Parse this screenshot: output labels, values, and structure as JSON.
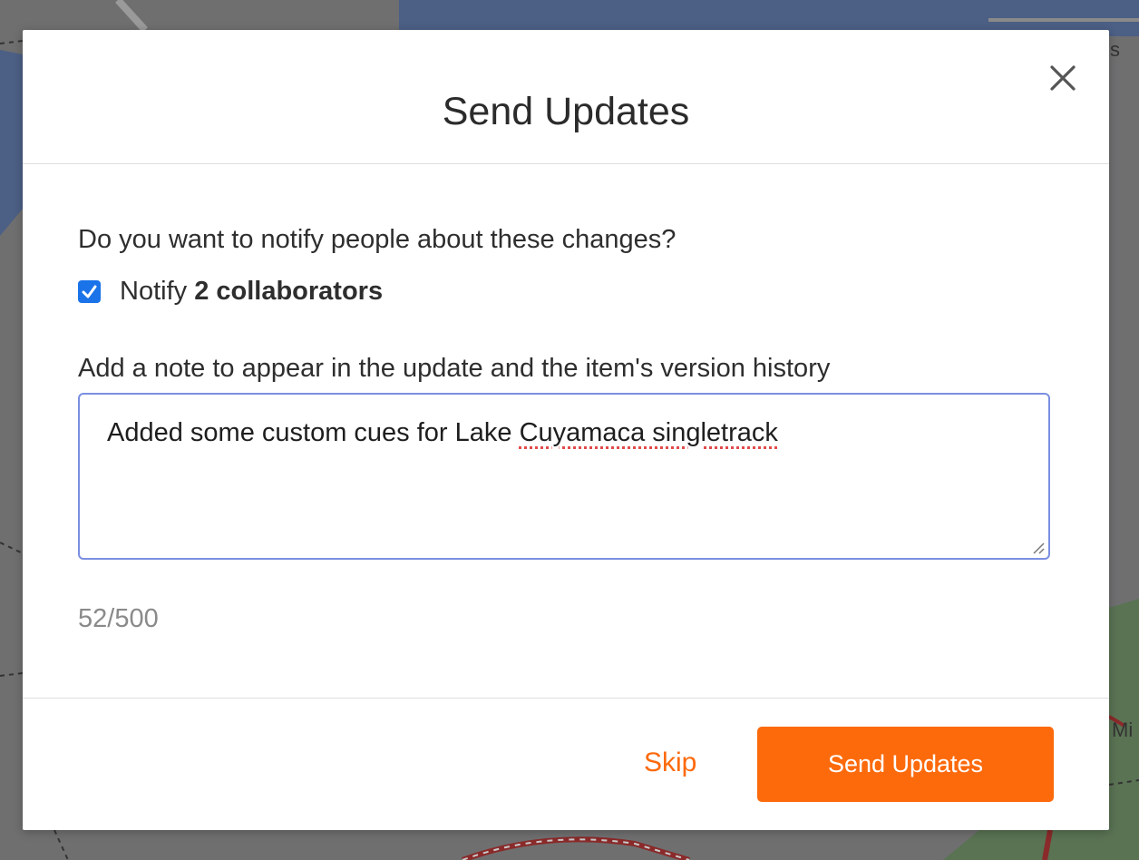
{
  "background": {
    "map_label_fragment_1": "s",
    "map_label_fragment_2": "Mi"
  },
  "dialog": {
    "title": "Send Updates",
    "close_icon": "close-icon",
    "question": "Do you want to notify people about these changes?",
    "notify": {
      "checked": true,
      "prefix": "Notify ",
      "emphasis": "2 collaborators"
    },
    "note_label": "Add a note to appear in the update and the item's version history",
    "note": {
      "part1": "Added some custom cues for Lake ",
      "part2": "Cuyamaca singletrack"
    },
    "char_count": "52/500",
    "skip_label": "Skip",
    "send_label": "Send Updates"
  },
  "colors": {
    "accent": "#fc6a0c",
    "checkbox": "#1a73e8",
    "textarea_border": "#7b8fe0"
  }
}
